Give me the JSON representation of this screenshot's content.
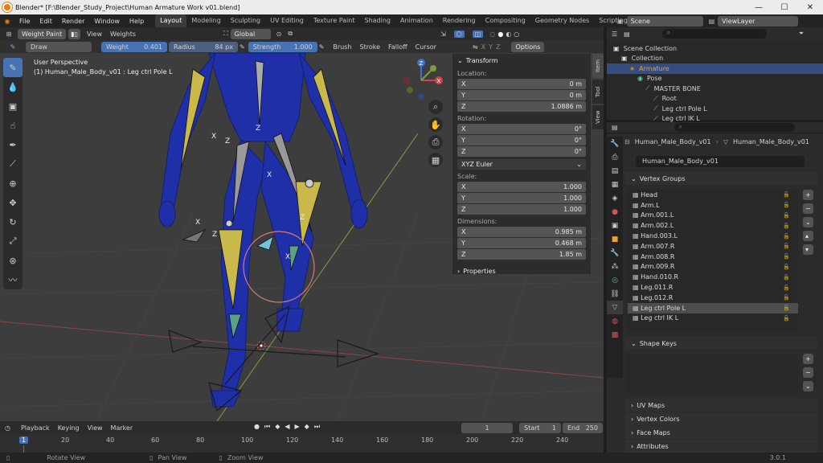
{
  "window": {
    "title": "Blender* [F:\\Blender_Study_Project\\Human Armature Work v01.blend]",
    "buttons": [
      "—",
      "☐",
      "✕"
    ]
  },
  "menu": [
    "File",
    "Edit",
    "Render",
    "Window",
    "Help"
  ],
  "workspaces": [
    "Layout",
    "Modeling",
    "Sculpting",
    "UV Editing",
    "Texture Paint",
    "Shading",
    "Animation",
    "Rendering",
    "Compositing",
    "Geometry Nodes",
    "Scripting"
  ],
  "active_workspace": "Layout",
  "scene": {
    "label": "Scene",
    "view_layer": "ViewLayer"
  },
  "viewport_header": {
    "mode": "Weight Paint",
    "menus": [
      "View",
      "Weights"
    ],
    "transform_orientation": "Global",
    "options": "Options"
  },
  "tool_header": {
    "brush": "Draw",
    "weight_label": "Weight",
    "weight_value": "0.401",
    "radius_label": "Radius",
    "radius_value": "84 px",
    "strength_label": "Strength",
    "strength_value": "1.000",
    "menus": [
      "Brush",
      "Stroke",
      "Falloff",
      "Cursor"
    ],
    "axes": [
      "X",
      "Y",
      "Z"
    ]
  },
  "viewport": {
    "perspective": "User Perspective",
    "object_info": "(1) Human_Male_Body_v01 : Leg ctrl Pole L"
  },
  "npanel": {
    "title": "Transform",
    "location_label": "Location:",
    "location": [
      {
        "axis": "X",
        "value": "0 m"
      },
      {
        "axis": "Y",
        "value": "0 m"
      },
      {
        "axis": "Z",
        "value": "1.0886 m"
      }
    ],
    "rotation_label": "Rotation:",
    "rotation": [
      {
        "axis": "X",
        "value": "0°"
      },
      {
        "axis": "Y",
        "value": "0°"
      },
      {
        "axis": "Z",
        "value": "0°"
      }
    ],
    "rotation_mode": "XYZ Euler",
    "scale_label": "Scale:",
    "scale": [
      {
        "axis": "X",
        "value": "1.000"
      },
      {
        "axis": "Y",
        "value": "1.000"
      },
      {
        "axis": "Z",
        "value": "1.000"
      }
    ],
    "dimensions_label": "Dimensions:",
    "dimensions": [
      {
        "axis": "X",
        "value": "0.985 m"
      },
      {
        "axis": "Y",
        "value": "0.468 m"
      },
      {
        "axis": "Z",
        "value": "1.85 m"
      }
    ],
    "properties_label": "Properties"
  },
  "side_tabs": [
    "Item",
    "Tool",
    "View"
  ],
  "outliner": {
    "rows": [
      {
        "label": "Scene Collection",
        "indent": 0
      },
      {
        "label": "Collection",
        "indent": 1
      },
      {
        "label": "Armature",
        "indent": 2
      },
      {
        "label": "Pose",
        "indent": 3
      },
      {
        "label": "MASTER BONE",
        "indent": 4
      },
      {
        "label": "Root",
        "indent": 5
      },
      {
        "label": "Leg ctrl Pole L",
        "indent": 5
      },
      {
        "label": "Leg ctrl IK L",
        "indent": 5
      }
    ]
  },
  "properties": {
    "breadcrumb_object": "Human_Male_Body_v01",
    "breadcrumb_data": "Human_Male_Body_v01",
    "mesh_name": "Human_Male_Body_v01",
    "vertex_groups_title": "Vertex Groups",
    "vertex_groups": [
      "Head",
      "Arm.L",
      "Arm.001.L",
      "Arm.002.L",
      "Hand.003.L",
      "Arm.007.R",
      "Arm.008.R",
      "Arm.009.R",
      "Hand.010.R",
      "Leg.011.R",
      "Leg.012.R",
      "Leg ctrl Pole L",
      "Leg ctrl IK L"
    ],
    "selected_group": "Leg ctrl Pole L",
    "shape_keys_title": "Shape Keys",
    "sections": [
      "UV Maps",
      "Vertex Colors",
      "Face Maps",
      "Attributes"
    ]
  },
  "timeline": {
    "menus": [
      "Playback",
      "Keying",
      "View",
      "Marker"
    ],
    "current_frame": "1",
    "start_label": "Start",
    "start": "1",
    "end_label": "End",
    "end": "250",
    "ticks": [
      "1",
      "20",
      "40",
      "60",
      "80",
      "100",
      "120",
      "140",
      "160",
      "180",
      "200",
      "220",
      "240"
    ]
  },
  "status": {
    "items": [
      "Rotate View",
      "Pan View",
      "Zoom View"
    ],
    "version": "3.0.1"
  },
  "colors": {
    "accent": "#4772b3",
    "armature": "#e87d0d",
    "body": "#1e2fa8",
    "bone_yellow": "#c9b84a"
  }
}
